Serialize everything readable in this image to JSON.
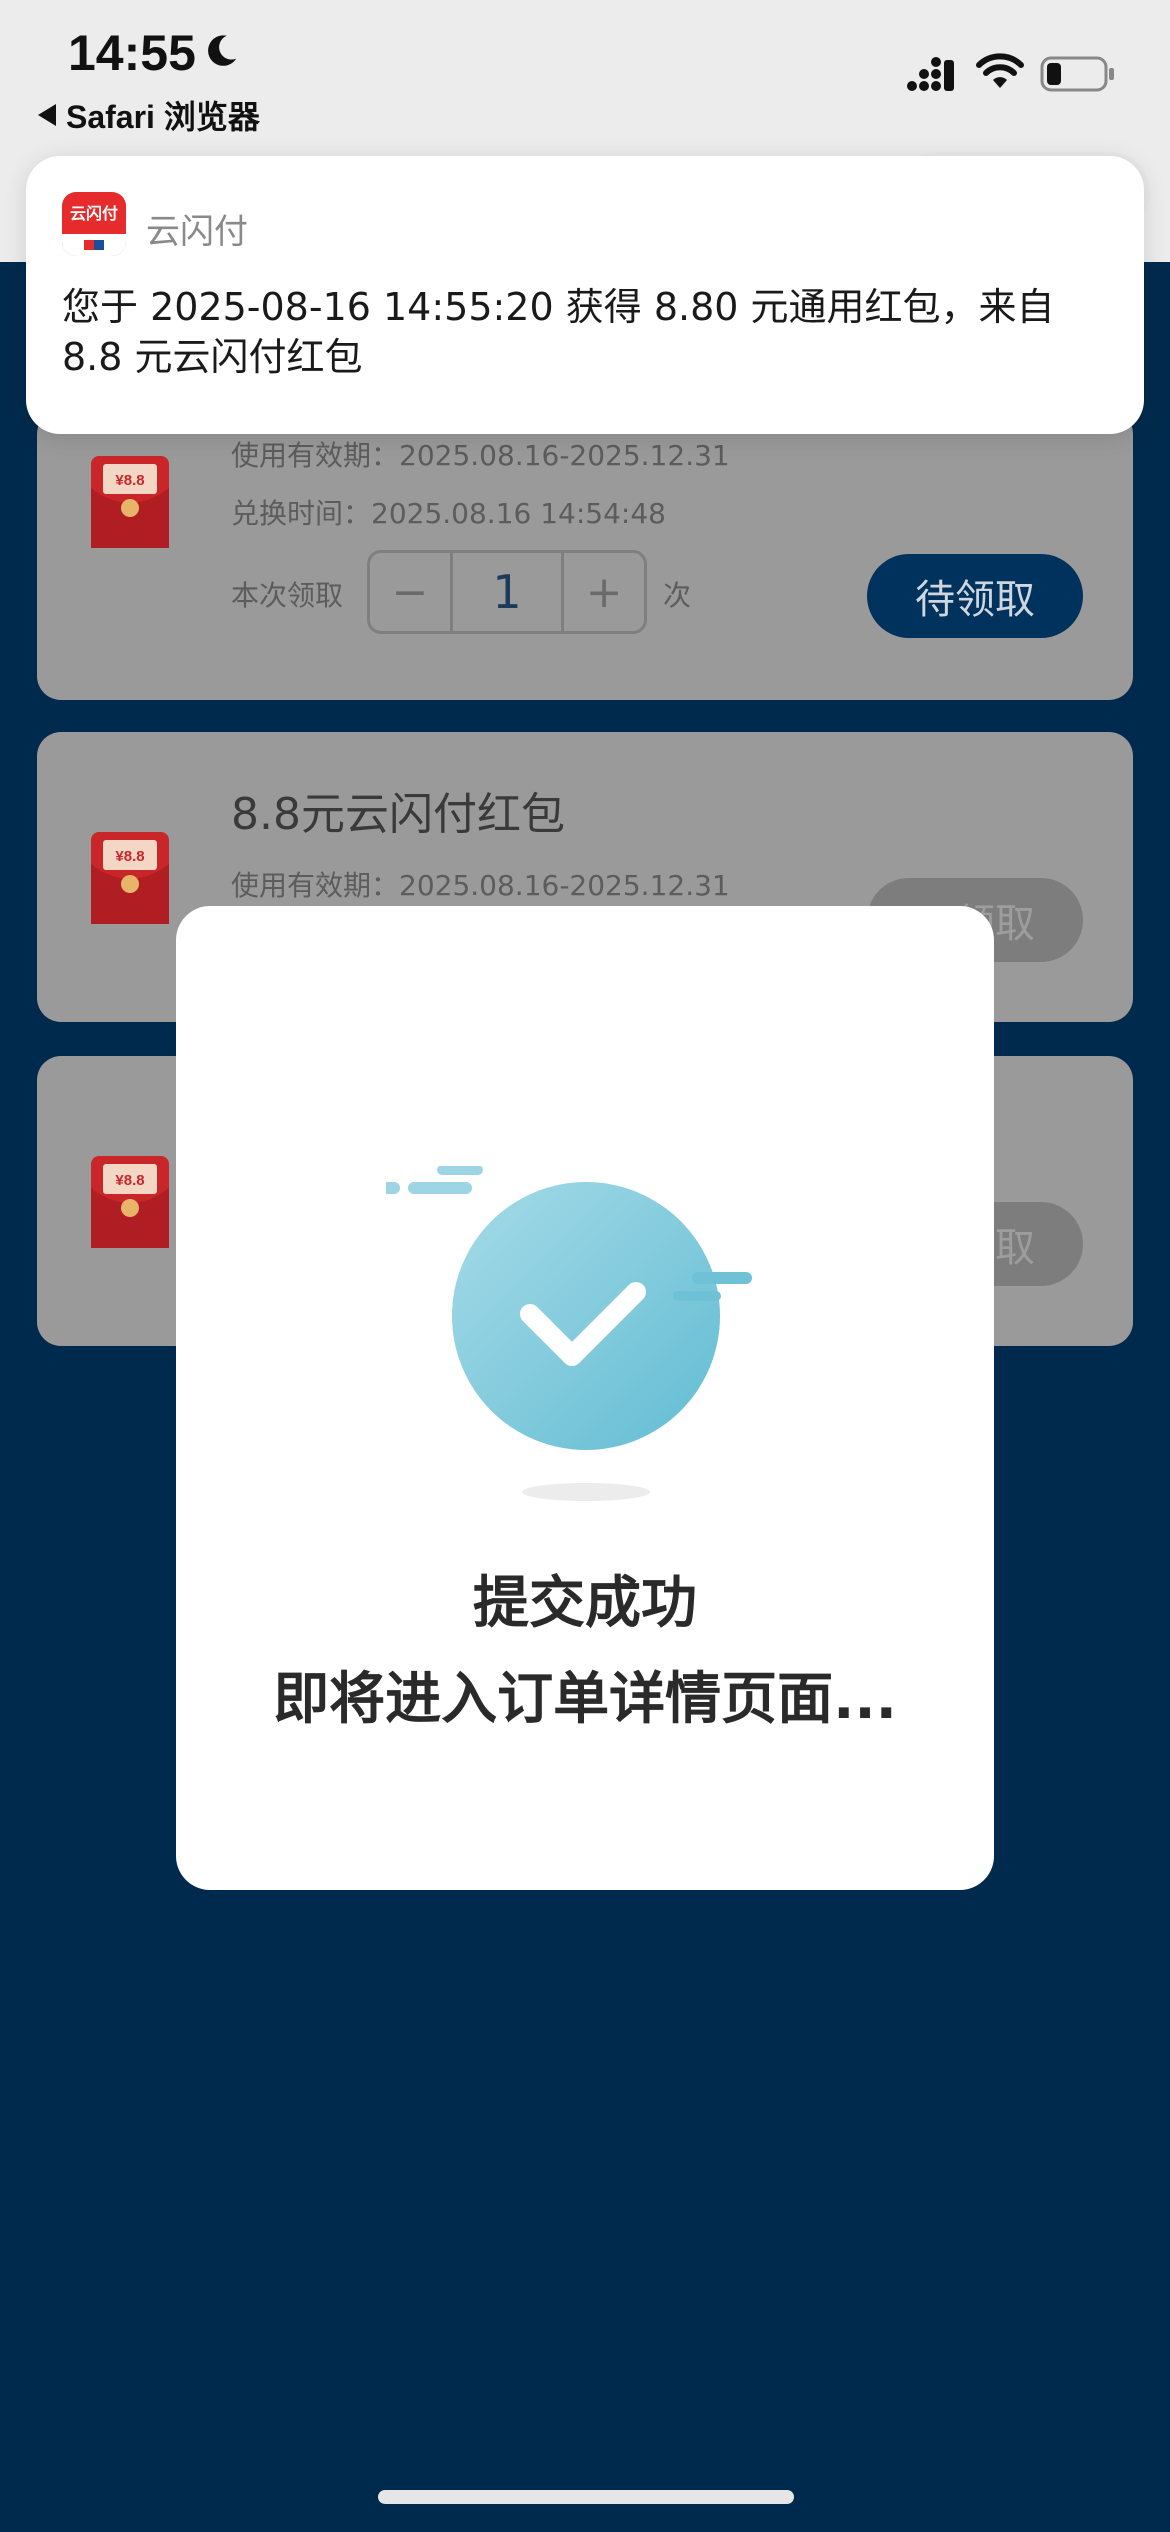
{
  "status_bar": {
    "time": "14:55",
    "back_app": "Safari 浏览器"
  },
  "notification": {
    "app_name": "云闪付",
    "app_icon_label": "云闪付",
    "message": "您于 2025-08-16 14:55:20 获得 8.80 元通用红包，来自 8.8 元云闪付红包"
  },
  "cards": [
    {
      "title": "",
      "validity": "使用有效期：2025.08.16-2025.12.31",
      "redeem_time": "兑换时间：2025.08.16 14:54:48",
      "qty_label": "本次领取",
      "qty_value": "1",
      "times_label": "次",
      "button": "待领取",
      "envelope_label": "¥8.8"
    },
    {
      "title": "8.8元云闪付红包",
      "validity": "使用有效期：2025.08.16-2025.12.31",
      "button": "已领取",
      "envelope_label": "¥8.8"
    },
    {
      "title": "",
      "button": "已领取",
      "envelope_label": "¥8.8"
    }
  ],
  "modal": {
    "title": "提交成功",
    "subtitle": "即将进入订单详情页面..."
  },
  "colors": {
    "page_bg": "#002a4d",
    "primary_button": "#00325e",
    "check_circle": "#7fc9dc",
    "brand_red": "#e52b2b"
  }
}
